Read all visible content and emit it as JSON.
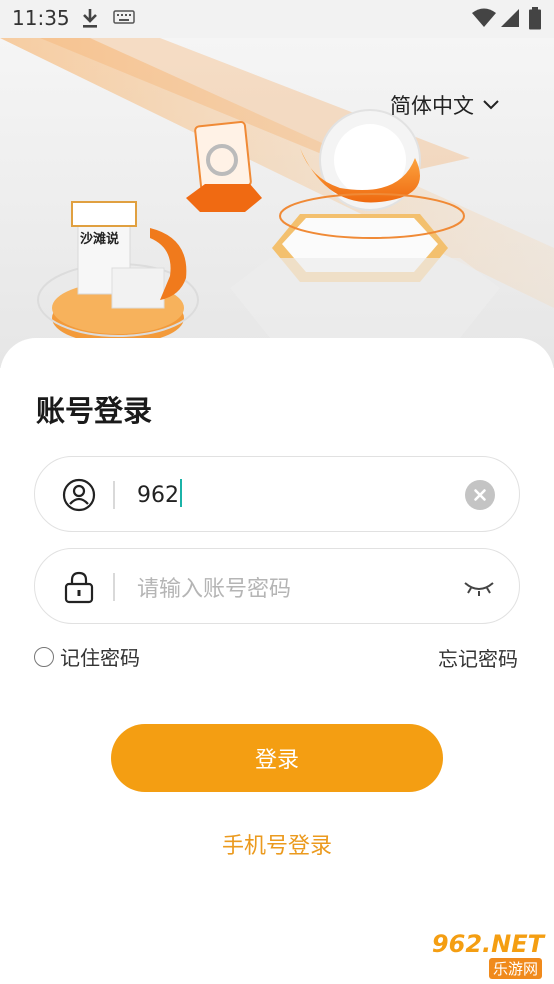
{
  "status_bar": {
    "time": "11:35",
    "icons": [
      "download-icon",
      "keyboard-icon",
      "wifi-icon",
      "signal-icon",
      "battery-icon"
    ]
  },
  "hero": {
    "language": "简体中文",
    "sign_text": "沙滩说"
  },
  "login": {
    "title": "账号登录",
    "account_value": "962",
    "password_placeholder": "请输入账号密码",
    "remember_label": "记住密码",
    "forgot_label": "忘记密码",
    "submit_label": "登录",
    "phone_login_label": "手机号登录"
  },
  "watermark": {
    "text_main": "962.NET",
    "text_sub": "乐游网"
  },
  "colors": {
    "accent": "#f49e12",
    "link": "#eb9a1e",
    "caret": "#1bb3a8"
  }
}
